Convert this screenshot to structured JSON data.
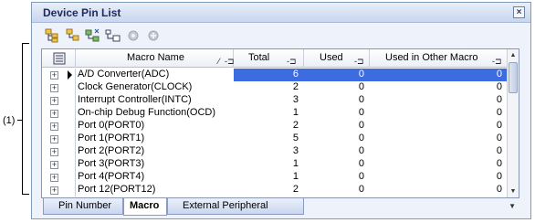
{
  "callout": {
    "label": "(1)"
  },
  "panel": {
    "title": "Device Pin List",
    "close_glyph": "⊠"
  },
  "toolbar": {
    "buttons": [
      {
        "name": "expand-all-icon"
      },
      {
        "name": "collapse-all-icon"
      },
      {
        "name": "filter-icon"
      },
      {
        "name": "tree-icon"
      },
      {
        "name": "disabled-gear-icon"
      },
      {
        "name": "disabled-gear2-icon"
      }
    ]
  },
  "grid": {
    "columns": {
      "macro_name": "Macro Name",
      "total": "Total",
      "used": "Used",
      "used_other": "Used in Other Macro"
    },
    "pin_glyph": "-⊐",
    "rows": [
      {
        "name": "A/D Converter(ADC)",
        "total": "6",
        "used": "0",
        "used_other": "0",
        "selected": true
      },
      {
        "name": "Clock Generator(CLOCK)",
        "total": "2",
        "used": "0",
        "used_other": "0"
      },
      {
        "name": "Interrupt Controller(INTC)",
        "total": "3",
        "used": "0",
        "used_other": "0"
      },
      {
        "name": "On-chip Debug Function(OCD)",
        "total": "1",
        "used": "0",
        "used_other": "0"
      },
      {
        "name": "Port 0(PORT0)",
        "total": "2",
        "used": "0",
        "used_other": "0"
      },
      {
        "name": "Port 1(PORT1)",
        "total": "5",
        "used": "0",
        "used_other": "0"
      },
      {
        "name": "Port 2(PORT2)",
        "total": "3",
        "used": "0",
        "used_other": "0"
      },
      {
        "name": "Port 3(PORT3)",
        "total": "1",
        "used": "0",
        "used_other": "0"
      },
      {
        "name": "Port 4(PORT4)",
        "total": "1",
        "used": "0",
        "used_other": "0"
      },
      {
        "name": "Port 12(PORT12)",
        "total": "2",
        "used": "0",
        "used_other": "0"
      }
    ]
  },
  "tabs": [
    {
      "label": "Pin Number",
      "active": false
    },
    {
      "label": "Macro",
      "active": true
    },
    {
      "label": "External Peripheral",
      "active": false
    }
  ]
}
